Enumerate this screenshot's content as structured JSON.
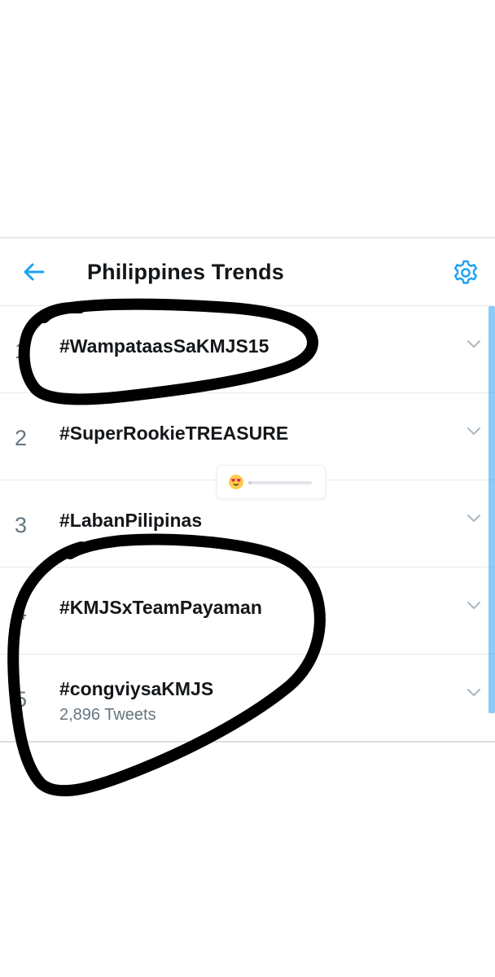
{
  "header": {
    "title": "Philippines Trends",
    "back_icon": "arrow-left-icon",
    "settings_icon": "gear-icon",
    "accent_color": "#1da1f2"
  },
  "trends": [
    {
      "rank": "1",
      "name": "#WampataasSaKMJS15",
      "meta": ""
    },
    {
      "rank": "2",
      "name": "#SuperRookieTREASURE",
      "meta": ""
    },
    {
      "rank": "3",
      "name": "#LabanPilipinas",
      "meta": ""
    },
    {
      "rank": "4",
      "name": "#KMJSxTeamPayaman",
      "meta": ""
    },
    {
      "rank": "5",
      "name": "#congviysaKMJS",
      "meta": "2,896 Tweets"
    }
  ],
  "reaction_slider": {
    "emoji_icon": "heart-eyes-emoji-icon",
    "level": 0.05
  },
  "annotations": {
    "ink_color": "#000000",
    "marks": [
      "hand-drawn circle around trend 1",
      "hand-drawn circle around trends 4 and 5"
    ]
  }
}
